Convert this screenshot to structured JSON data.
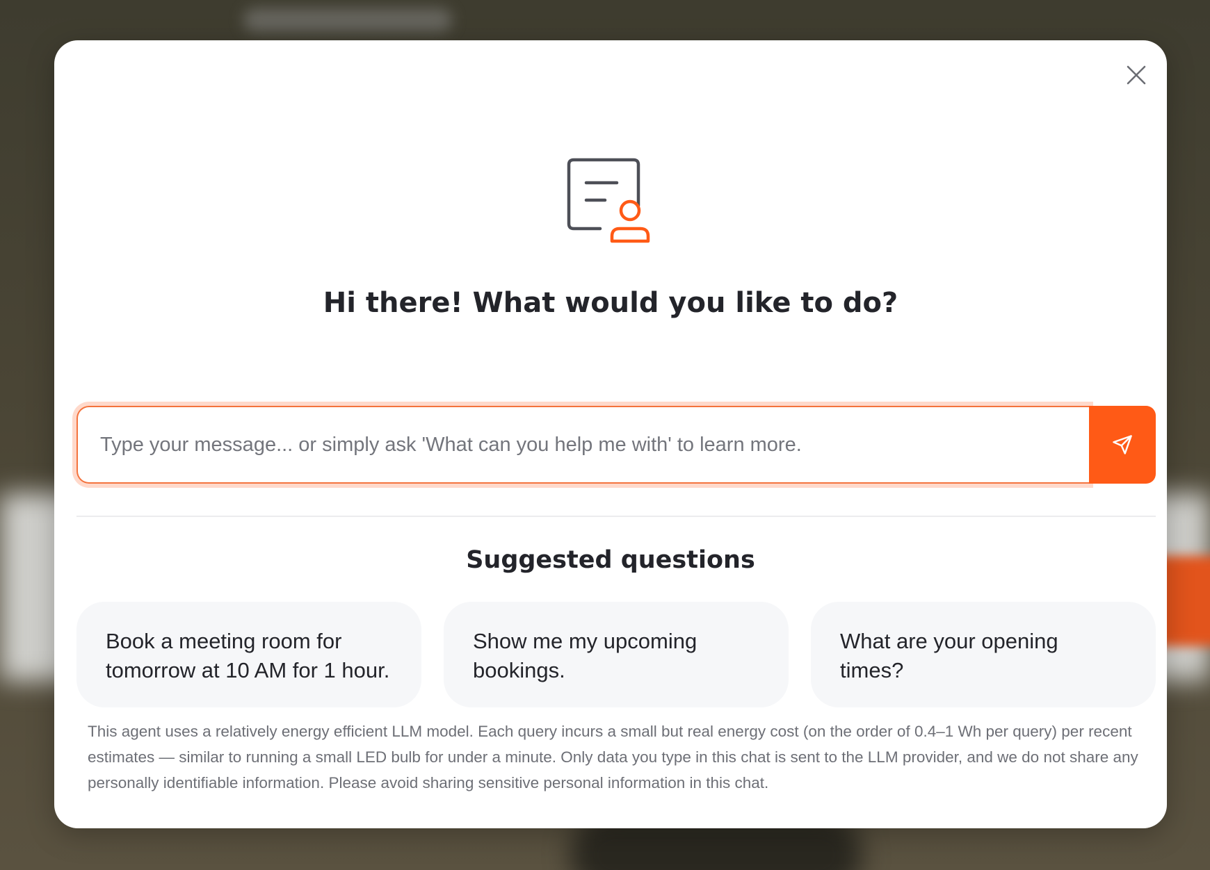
{
  "modal": {
    "close_icon": "close-icon",
    "hero_icon": "agent-profile-icon",
    "title": "Hi there! What would you like to do?"
  },
  "composer": {
    "input_value": "",
    "placeholder": "Type your message... or simply ask 'What can you help me with' to learn more.",
    "send_icon": "send-icon"
  },
  "suggestions": {
    "heading": "Suggested questions",
    "items": [
      {
        "label": "Book a meeting room for tomorrow at 10 AM for 1 hour."
      },
      {
        "label": "Show me my upcoming bookings."
      },
      {
        "label": "What are your opening times?"
      }
    ]
  },
  "disclaimer": "This agent uses a relatively energy efficient LLM model. Each query incurs a small but real energy cost (on the order of 0.4–1 Wh per query) per recent estimates — similar to running a small LED bulb for under a minute. Only data you type in this chat is sent to the LLM provider, and we do not share any personally identifiable information. Please avoid sharing sensitive personal information in this chat.",
  "colors": {
    "accent": "#ff5a16",
    "text_primary": "#23242a",
    "text_muted": "#6d6f76",
    "card_bg": "#f6f7f9"
  }
}
